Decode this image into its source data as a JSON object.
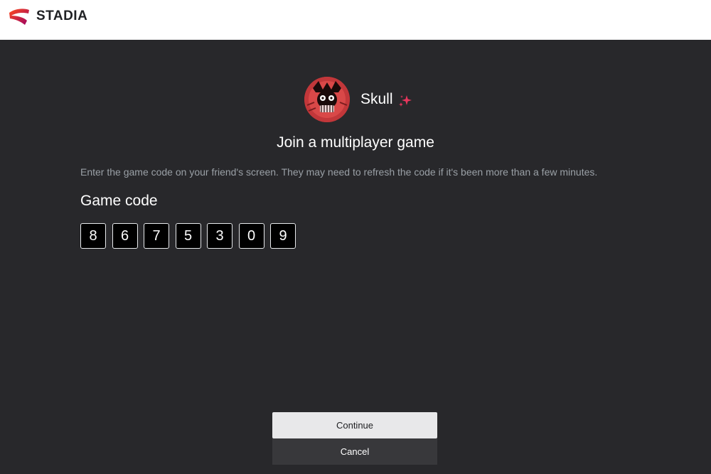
{
  "header": {
    "brand": "STADIA",
    "brand_colors": [
      "#ff4c1d",
      "#9b0063"
    ]
  },
  "player": {
    "name": "Skull",
    "avatar_icon": "skull-avatar",
    "badge_icon": "sparkle-icon",
    "badge_color": "#e8365d"
  },
  "dialog": {
    "title": "Join a multiplayer game",
    "description": "Enter the game code on your friend's screen. They may need to refresh the code if it's been more than a few minutes.",
    "code_label": "Game code",
    "code_digits": [
      "8",
      "6",
      "7",
      "5",
      "3",
      "0",
      "9"
    ]
  },
  "actions": {
    "continue_label": "Continue",
    "cancel_label": "Cancel"
  }
}
